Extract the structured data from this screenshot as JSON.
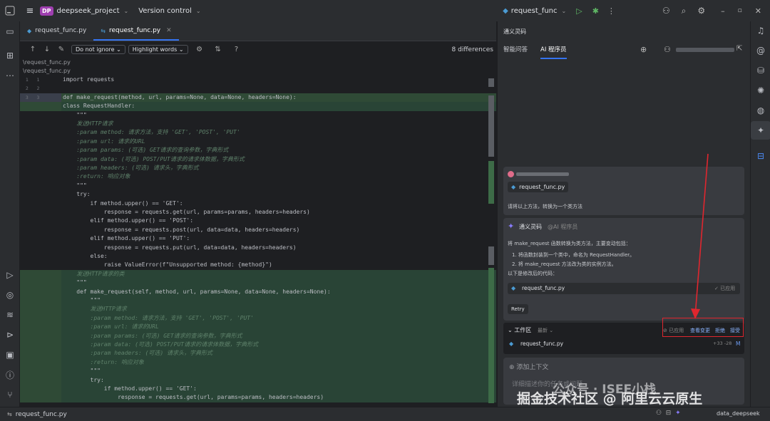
{
  "titlebar": {
    "project_badge": "DP",
    "project_name": "deepseek_project",
    "vcs_label": "Version control",
    "run_config": "request_func"
  },
  "editor": {
    "tabs": [
      {
        "label": "request_func.py",
        "active": false
      },
      {
        "label": "request_func.py",
        "active": true
      }
    ],
    "toolbar": {
      "ignore_select": "Do not ignore",
      "highlight_select": "Highlight words",
      "differences": "8 differences"
    },
    "paths": [
      "\\request_func.py",
      "\\request_func.py"
    ]
  },
  "code_left": [
    {
      "n": "1",
      "t": "import requests"
    },
    {
      "n": "2",
      "t": ""
    },
    {
      "n": "3",
      "t": "def make_request(method, url, params=None, data=None, headers=None):"
    },
    {
      "n": "",
      "t": "class RequestHandler:"
    },
    {
      "n": "",
      "t": "    \"\"\""
    },
    {
      "n": "",
      "t": "    发送HTTP请求"
    },
    {
      "n": "",
      "t": "    :param method: 请求方法，支持 'GET', 'POST', 'PUT'"
    },
    {
      "n": "",
      "t": "    :param url: 请求的URL"
    },
    {
      "n": "",
      "t": "    :param params: (可选) GET请求的查询参数，字典形式"
    },
    {
      "n": "",
      "t": "    :param data: (可选) POST/PUT请求的请求体数据，字典形式"
    },
    {
      "n": "",
      "t": "    :param headers: (可选) 请求头，字典形式"
    },
    {
      "n": "",
      "t": "    :return: 响应对象"
    },
    {
      "n": "",
      "t": "    \"\"\""
    },
    {
      "n": "",
      "t": "    try:"
    },
    {
      "n": "",
      "t": "        if method.upper() == 'GET':"
    },
    {
      "n": "",
      "t": "            response = requests.get(url, params=params, headers=headers)"
    },
    {
      "n": "",
      "t": "        elif method.upper() == 'POST':"
    },
    {
      "n": "",
      "t": "            response = requests.post(url, data=data, headers=headers)"
    },
    {
      "n": "",
      "t": "        elif method.upper() == 'PUT':"
    },
    {
      "n": "",
      "t": "            response = requests.put(url, data=data, headers=headers)"
    },
    {
      "n": "",
      "t": "        else:"
    },
    {
      "n": "",
      "t": "            raise ValueError(f\"Unsupported method: {method}\")"
    },
    {
      "n": "",
      "t": "    发送HTTP请求的类"
    },
    {
      "n": "",
      "t": "    \"\"\""
    },
    {
      "n": "",
      "t": "    def make_request(self, method, url, params=None, data=None, headers=None):"
    },
    {
      "n": "",
      "t": "        \"\"\""
    },
    {
      "n": "",
      "t": "        发送HTTP请求"
    },
    {
      "n": "",
      "t": "        :param method: 请求方法，支持 'GET', 'POST', 'PUT'"
    },
    {
      "n": "",
      "t": "        :param url: 请求的URL"
    },
    {
      "n": "",
      "t": "        :param params: (可选) GET请求的查询参数，字典形式"
    },
    {
      "n": "",
      "t": "        :param data: (可选) POST/PUT请求的请求体数据，字典形式"
    },
    {
      "n": "",
      "t": "        :param headers: (可选) 请求头，字典形式"
    },
    {
      "n": "",
      "t": "        :return: 响应对象"
    },
    {
      "n": "",
      "t": "        \"\"\""
    },
    {
      "n": "",
      "t": "        try:"
    },
    {
      "n": "",
      "t": "            if method.upper() == 'GET':"
    },
    {
      "n": "",
      "t": "                response = requests.get(url, params=params, headers=headers)"
    }
  ],
  "ai_panel": {
    "title": "通义灵码",
    "tabs": [
      "智能问答",
      "AI 程序员"
    ],
    "user_file": "request_func.py",
    "user_prompt": "请将以上方法，转换为一个类方法",
    "assistant_name": "通义灵码",
    "assistant_role": "@AI 程序员",
    "reply_intro": "将 make_request 函数转换为类方法，主要变动包括：",
    "reply_items": [
      "1. 将函数封装到一个类中，命名为 RequestHandler。",
      "2. 将 make_request 方法改为类的实例方法。"
    ],
    "reply_outro": "以下是修改后的代码：",
    "code_file": "request_func.py",
    "applied_label": "已应用",
    "retry_label": "Retry",
    "workspace_label": "工作区",
    "workspace_sub": "最新",
    "ws_applied": "已应用",
    "ws_view_changes": "查看变更",
    "ws_reject": "拒绝",
    "ws_accept": "接受",
    "ws_file": "request_func.py",
    "ws_stats": "+33 -28",
    "ws_status": "M",
    "context_label": "添加上下文",
    "input_placeholder": "详细描述你的任务或问题"
  },
  "statusbar": {
    "file": "request_func.py",
    "right_label": "data_deepseek"
  },
  "watermarks": [
    "公众号 · ISEE小栈",
    "掘金技术社区 @ 阿里云云原生"
  ],
  "colors": {
    "accent": "#3574f0",
    "added": "#294436",
    "highlight_box": "#e0262e"
  }
}
